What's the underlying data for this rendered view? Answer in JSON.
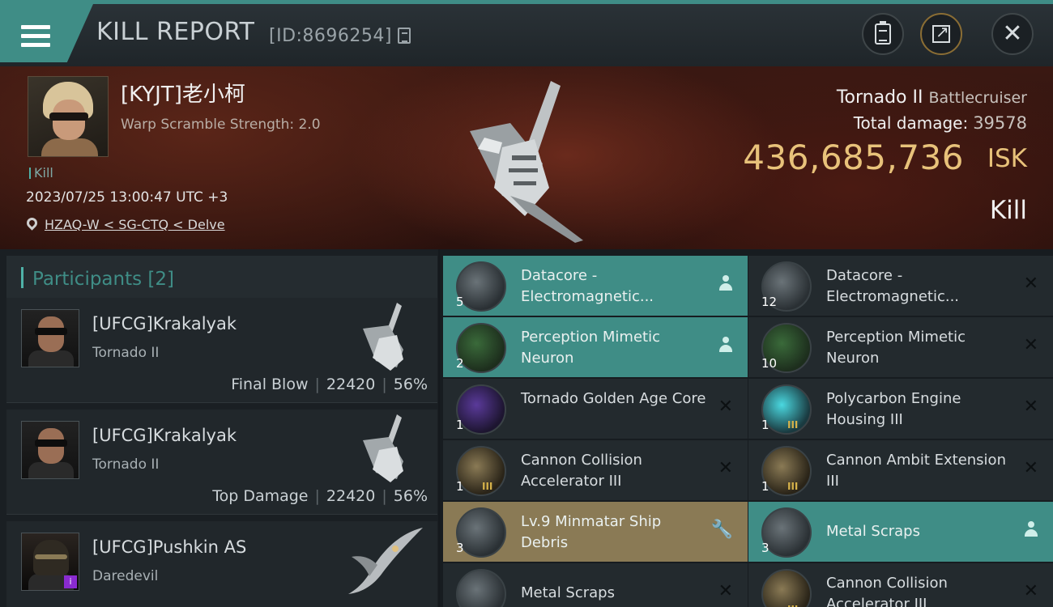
{
  "header": {
    "title": "KILL REPORT",
    "report_id": "[ID:8696254]"
  },
  "victim": {
    "name": "[KYJT]老小柯",
    "warp_scramble": "Warp Scramble Strength: 2.0",
    "kill_tag": "Kill",
    "datetime": "2023/07/25 13:00:47 UTC +3",
    "location": "HZAQ-W < SG-CTQ < Delve",
    "ship": "Tornado II",
    "ship_class": "Battlecruiser",
    "total_damage_label": "Total damage:",
    "total_damage": "39578",
    "isk_value": "436,685,736",
    "isk_unit": "ISK",
    "result": "Kill"
  },
  "participants": {
    "header": "Participants [2]",
    "list": [
      {
        "name": "[UFCG]Krakalyak",
        "ship": "Tornado II",
        "role": "Final Blow",
        "damage": "22420",
        "percent": "56%"
      },
      {
        "name": "[UFCG]Krakalyak",
        "ship": "Tornado II",
        "role": "Top Damage",
        "damage": "22420",
        "percent": "56%"
      },
      {
        "name": "[UFCG]Pushkin AS",
        "ship": "Daredevil",
        "role": "",
        "damage": "",
        "percent": ""
      }
    ]
  },
  "items": [
    {
      "qty": "5",
      "name": "Datacore - Electromagnetic...",
      "state": "dropped",
      "icon": "datacore-icon"
    },
    {
      "qty": "12",
      "name": "Datacore - Electromagnetic...",
      "state": "destroyed",
      "icon": "datacore-icon"
    },
    {
      "qty": "2",
      "name": "Perception Mimetic Neuron",
      "state": "dropped",
      "icon": "neuron-icon"
    },
    {
      "qty": "10",
      "name": "Perception Mimetic Neuron",
      "state": "destroyed",
      "icon": "neuron-icon"
    },
    {
      "qty": "1",
      "name": "Tornado Golden Age Core",
      "state": "destroyed",
      "icon": "core-icon"
    },
    {
      "qty": "1",
      "name": "Polycarbon Engine Housing III",
      "state": "destroyed",
      "icon": "engine-housing-icon",
      "tier": "III"
    },
    {
      "qty": "1",
      "name": "Cannon Collision Accelerator III",
      "state": "destroyed",
      "icon": "cannon-module-icon",
      "tier": "III"
    },
    {
      "qty": "1",
      "name": "Cannon Ambit Extension III",
      "state": "destroyed",
      "icon": "cannon-module-icon",
      "tier": "III"
    },
    {
      "qty": "3",
      "name": "Lv.9 Minmatar Ship Debris",
      "state": "fitted",
      "icon": "ship-debris-icon"
    },
    {
      "qty": "3",
      "name": "Metal Scraps",
      "state": "dropped",
      "icon": "metal-scraps-icon"
    },
    {
      "qty": "",
      "name": "Metal Scraps",
      "state": "destroyed",
      "icon": "metal-scraps-icon"
    },
    {
      "qty": "",
      "name": "Cannon Collision Accelerator III",
      "state": "destroyed",
      "icon": "cannon-module-icon",
      "tier": "III"
    }
  ],
  "colors": {
    "accent_teal": "#3f8d86",
    "isk_gold": "#e8c27a",
    "fitted_brass": "#8a7a55"
  }
}
